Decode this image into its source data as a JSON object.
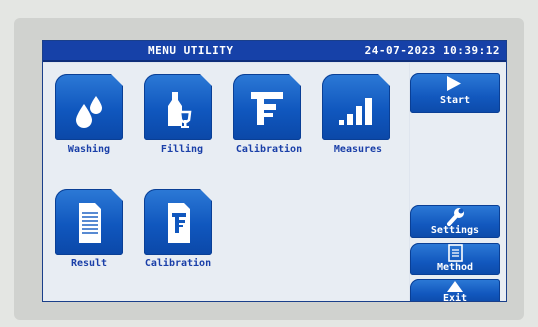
{
  "header": {
    "title": "MENU UTILITY",
    "datetime": "24-07-2023 10:39:12"
  },
  "tiles": [
    {
      "label": "Washing",
      "icon": "water-drops-icon"
    },
    {
      "label": "Filling",
      "icon": "bottle-glass-icon"
    },
    {
      "label": "Calibration",
      "icon": "caliper-icon"
    },
    {
      "label": "Measures",
      "icon": "signal-bars-icon"
    },
    {
      "label": "Result",
      "icon": "document-icon"
    },
    {
      "label": "Calibration",
      "icon": "caliper-document-icon"
    }
  ],
  "sidebar": {
    "start": "Start",
    "settings": "Settings",
    "method": "Method",
    "exit": "Exit"
  },
  "colors": {
    "accent": "#1057be",
    "header": "#1641a8",
    "label": "#1a3fa8",
    "screen": "#e8edf3"
  }
}
